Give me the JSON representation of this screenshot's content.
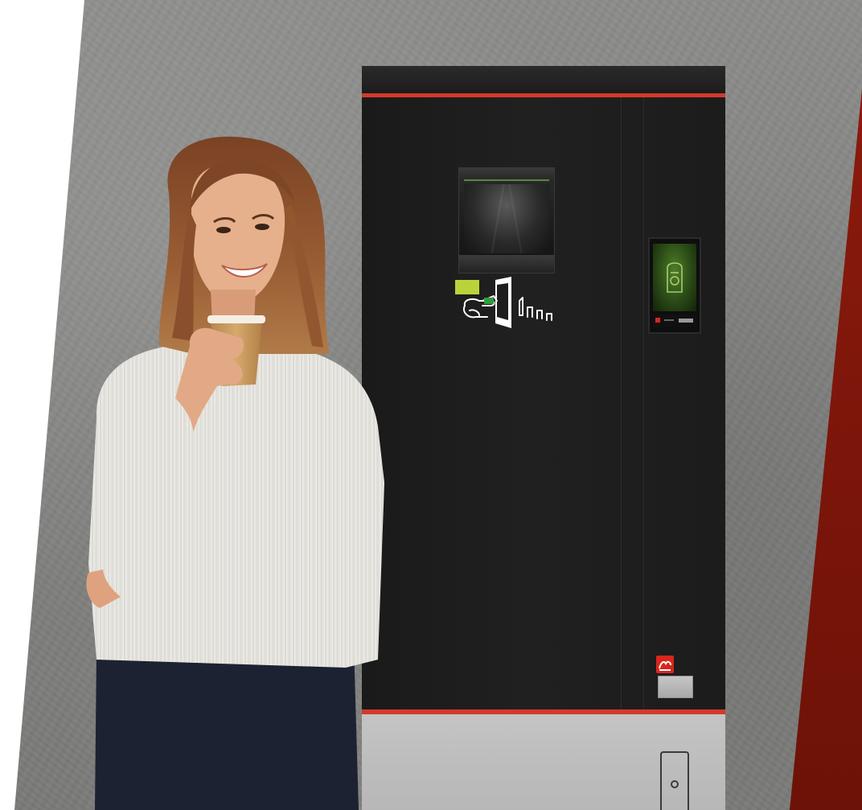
{
  "colors": {
    "wall": "#858583",
    "red_band": "#801709",
    "machine_body": "#1e1e1e",
    "accent_stripe": "#d33a2c",
    "machine_base": "#bdbdbd",
    "screen_green": "#4f7d2a",
    "brand_red": "#d8261c",
    "sweater": "#ecebe7",
    "trousers": "#1c2232",
    "cup": "#c9995a",
    "hair": "#8a4f2c"
  },
  "icons": {
    "dispenser": "cup-dispenser-icon",
    "instruction": "insert-cup-instruction-icon",
    "screen": "payment-screen-icon",
    "logo": "brand-logo-icon"
  }
}
